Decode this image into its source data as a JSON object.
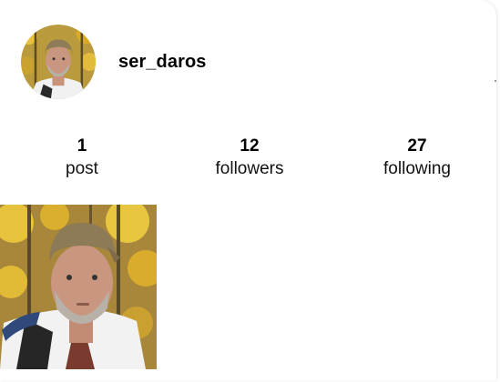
{
  "profile": {
    "username": "ser_daros",
    "avatar_icon": "profile-photo"
  },
  "stats": {
    "posts": {
      "count": "1",
      "label": "post"
    },
    "followers": {
      "count": "12",
      "label": "followers"
    },
    "following": {
      "count": "27",
      "label": "following"
    }
  },
  "posts": [
    {
      "icon": "post-photo"
    }
  ],
  "colors": {
    "background": "#ffffff",
    "text": "#000000",
    "foliage_yellow": "#e0b52a",
    "bandana": "#8c7a5a",
    "jacket": "#f2f2f2"
  }
}
